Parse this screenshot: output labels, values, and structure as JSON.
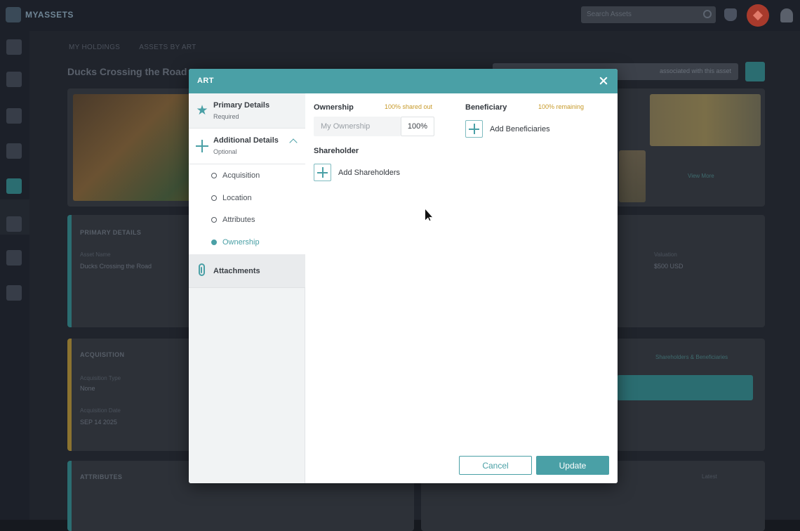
{
  "app": {
    "logo_text": "MYASSETS",
    "top_search_placeholder": "Search Assets"
  },
  "background": {
    "breadcrumb_1": "MY HOLDINGS",
    "breadcrumb_2": "ASSETS BY ART",
    "page_title": "Ducks Crossing the Road",
    "assoc_label": "associated with this asset",
    "view_more": "View More",
    "primary_details_label": "PRIMARY DETAILS",
    "primary_name_small": "Asset Name",
    "primary_name_val": "Ducks Crossing the Road",
    "primary_value_small": "Valuation",
    "primary_value_val": "$500 USD",
    "acquisition_label": "ACQUISITION",
    "acq_type_small": "Acquisition Type",
    "acq_type_val": "None",
    "acq_date_small": "Acquisition Date",
    "acq_date_val": "SEP 14 2025",
    "attributes_label": "ATTRIBUTES",
    "latest_label": "Latest",
    "link_label": "Shareholders & Beneficiaries"
  },
  "modal": {
    "title": "ART",
    "nav": {
      "primary": {
        "title": "Primary Details",
        "subtitle": "Required"
      },
      "additional": {
        "title": "Additional Details",
        "subtitle": "Optional"
      },
      "sub_items": [
        "Acquisition",
        "Location",
        "Attributes",
        "Ownership"
      ],
      "attachments": {
        "title": "Attachments"
      }
    },
    "ownership": {
      "label": "Ownership",
      "status": "100% shared out",
      "input_placeholder": "My Ownership",
      "percent": "100%"
    },
    "beneficiary": {
      "label": "Beneficiary",
      "status": "100% remaining",
      "add_label": "Add Beneficiaries"
    },
    "shareholder": {
      "label": "Shareholder",
      "add_label": "Add Shareholders"
    },
    "buttons": {
      "cancel": "Cancel",
      "update": "Update"
    }
  },
  "colors": {
    "accent": "#4aa0a6",
    "warning": "#c79a2a"
  }
}
